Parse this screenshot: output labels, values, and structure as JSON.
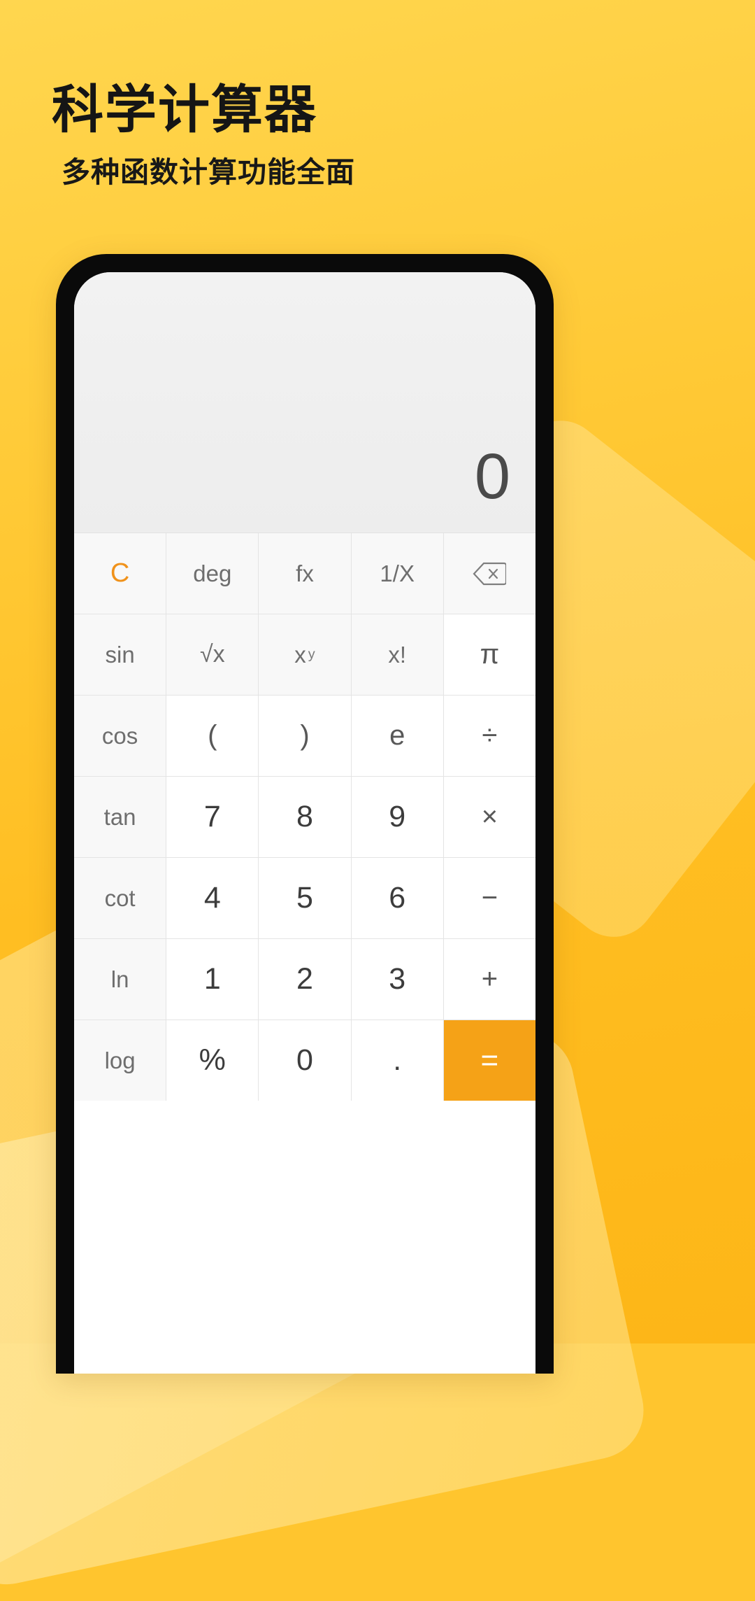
{
  "promo": {
    "title": "科学计算器",
    "subtitle": "多种函数计算功能全面",
    "background_color": "#FFC52E",
    "title_color": "#151515"
  },
  "calculator": {
    "display": {
      "value": "0",
      "background_color": "#F0F0F0",
      "text_color": "#4A4A4A"
    },
    "accent_color": "#F5A217",
    "clear_color": "#F0921B",
    "keypad": {
      "columns": 5,
      "rows": [
        [
          {
            "label": "C",
            "name": "clear-button",
            "style": "clear",
            "tint": true
          },
          {
            "label": "deg",
            "name": "degree-mode-button",
            "style": "fn",
            "tint": true
          },
          {
            "label": "fx",
            "name": "function-button",
            "style": "fn",
            "tint": true
          },
          {
            "label": "1/X",
            "name": "reciprocal-button",
            "style": "fn",
            "tint": true
          },
          {
            "label": "",
            "name": "backspace-button",
            "style": "icon",
            "tint": true,
            "icon": "backspace-icon"
          }
        ],
        [
          {
            "label": "sin",
            "name": "sine-button",
            "style": "fn",
            "tint": true
          },
          {
            "label": "√x",
            "name": "square-root-button",
            "style": "sqrt",
            "tint": true
          },
          {
            "label": "x",
            "sup": "y",
            "name": "power-button",
            "style": "sup",
            "tint": true
          },
          {
            "label": "x!",
            "name": "factorial-button",
            "style": "fn",
            "tint": true
          },
          {
            "label": "π",
            "name": "pi-button",
            "style": "op",
            "tint": false
          }
        ],
        [
          {
            "label": "cos",
            "name": "cosine-button",
            "style": "fn",
            "tint": true
          },
          {
            "label": "(",
            "name": "left-parenthesis-button",
            "style": "op",
            "tint": false
          },
          {
            "label": ")",
            "name": "right-parenthesis-button",
            "style": "op",
            "tint": false
          },
          {
            "label": "e",
            "name": "euler-button",
            "style": "op",
            "tint": false
          },
          {
            "label": "÷",
            "name": "divide-button",
            "style": "op",
            "tint": false
          }
        ],
        [
          {
            "label": "tan",
            "name": "tangent-button",
            "style": "fn",
            "tint": true
          },
          {
            "label": "7",
            "name": "digit-7-button",
            "style": "num",
            "tint": false
          },
          {
            "label": "8",
            "name": "digit-8-button",
            "style": "num",
            "tint": false
          },
          {
            "label": "9",
            "name": "digit-9-button",
            "style": "num",
            "tint": false
          },
          {
            "label": "×",
            "name": "multiply-button",
            "style": "op",
            "tint": false
          }
        ],
        [
          {
            "label": "cot",
            "name": "cotangent-button",
            "style": "fn",
            "tint": true
          },
          {
            "label": "4",
            "name": "digit-4-button",
            "style": "num",
            "tint": false
          },
          {
            "label": "5",
            "name": "digit-5-button",
            "style": "num",
            "tint": false
          },
          {
            "label": "6",
            "name": "digit-6-button",
            "style": "num",
            "tint": false
          },
          {
            "label": "−",
            "name": "minus-button",
            "style": "op",
            "tint": false
          }
        ],
        [
          {
            "label": "ln",
            "name": "natural-log-button",
            "style": "fn",
            "tint": true
          },
          {
            "label": "1",
            "name": "digit-1-button",
            "style": "num",
            "tint": false
          },
          {
            "label": "2",
            "name": "digit-2-button",
            "style": "num",
            "tint": false
          },
          {
            "label": "3",
            "name": "digit-3-button",
            "style": "num",
            "tint": false
          },
          {
            "label": "+",
            "name": "plus-button",
            "style": "op",
            "tint": false
          }
        ],
        [
          {
            "label": "log",
            "name": "log-button",
            "style": "fn",
            "tint": true
          },
          {
            "label": "%",
            "name": "percent-button",
            "style": "num",
            "tint": false
          },
          {
            "label": "0",
            "name": "digit-0-button",
            "style": "num",
            "tint": false
          },
          {
            "label": ".",
            "name": "decimal-point-button",
            "style": "num",
            "tint": false
          },
          {
            "label": "=",
            "name": "equals-button",
            "style": "equals",
            "tint": false
          }
        ]
      ]
    }
  }
}
